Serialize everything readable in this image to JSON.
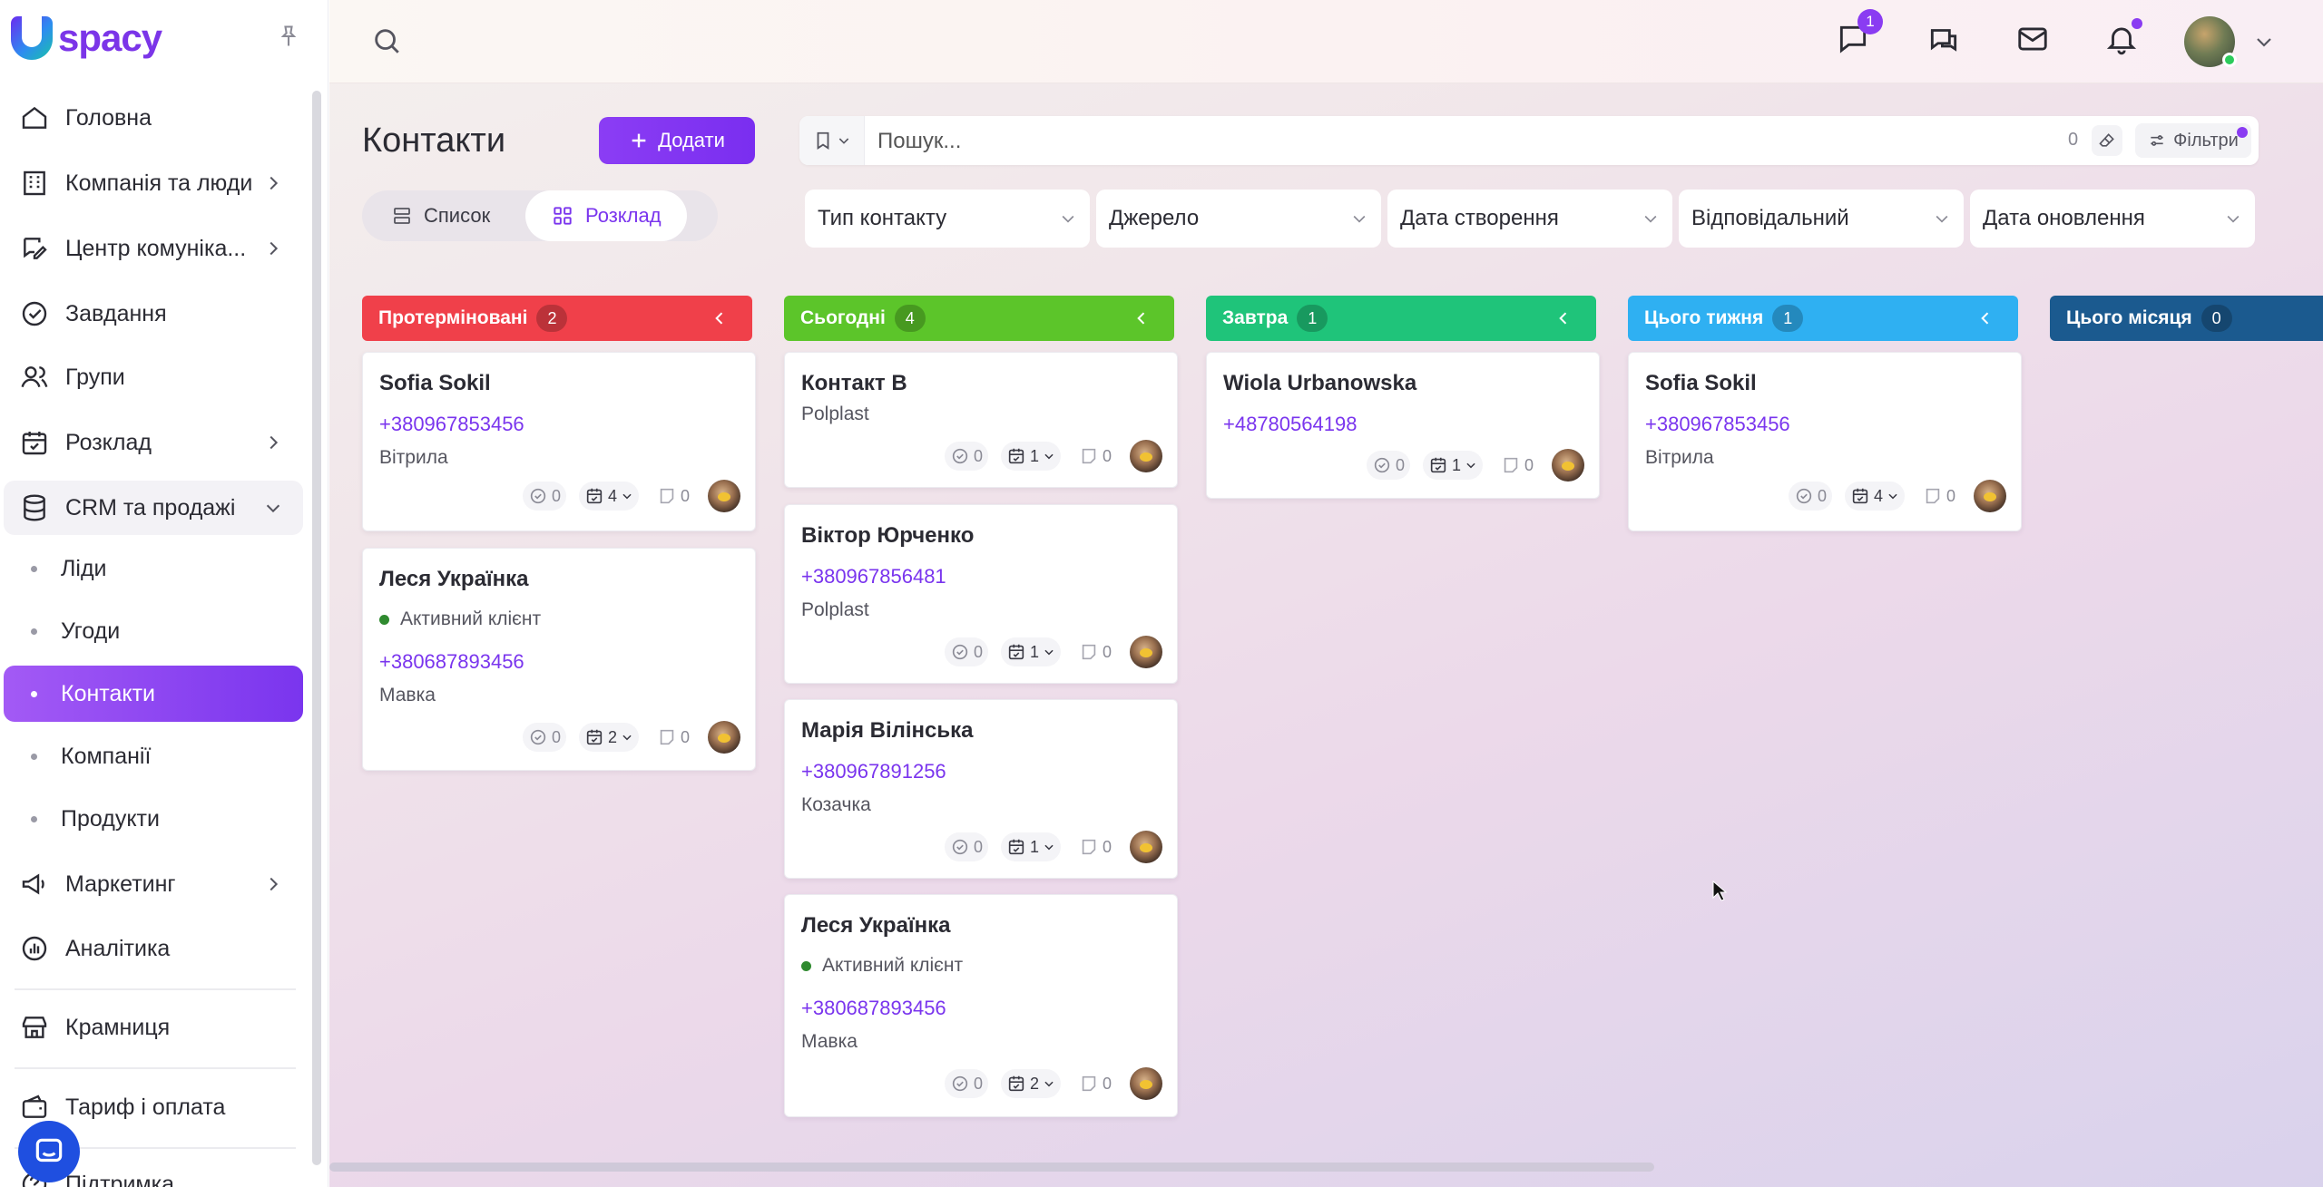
{
  "brand": {
    "logo_text": "spacy"
  },
  "sidebar": {
    "items": [
      {
        "label": "Головна",
        "icon": "home-icon"
      },
      {
        "label": "Компанія та люди",
        "icon": "building-icon"
      },
      {
        "label": "Центр комуніка...",
        "icon": "chat-edit-icon"
      },
      {
        "label": "Завдання",
        "icon": "check-circle-icon"
      },
      {
        "label": "Групи",
        "icon": "users-icon"
      },
      {
        "label": "Розклад",
        "icon": "calendar-icon"
      },
      {
        "label": "CRM та продажі",
        "icon": "database-icon"
      },
      {
        "label": "Маркетинг",
        "icon": "megaphone-icon"
      },
      {
        "label": "Аналітика",
        "icon": "chart-icon"
      },
      {
        "label": "Крамниця",
        "icon": "store-icon"
      },
      {
        "label": "Тариф і оплата",
        "icon": "wallet-icon"
      },
      {
        "label": "Підтримка",
        "icon": "support-icon"
      }
    ],
    "crm_sub": [
      "Ліди",
      "Угоди",
      "Контакти",
      "Компанії",
      "Продукти"
    ]
  },
  "topbar": {
    "messages_badge": "1"
  },
  "page": {
    "title": "Контакти",
    "add_label": "Додати",
    "view_list": "Список",
    "view_board": "Розклад",
    "search_placeholder": "Пошук...",
    "search_count": "0",
    "filters_label": "Фільтри",
    "filter_dropdowns": [
      "Тип контакту",
      "Джерело",
      "Дата створення",
      "Відповідальний",
      "Дата оновлення"
    ]
  },
  "colors": {
    "accent": "#7a35ee",
    "overdue": "#f0404a",
    "today": "#5cc52a",
    "tomorrow": "#1fc47a",
    "this_week": "#2fb0f2",
    "this_month": "#1b5a8f"
  },
  "columns": [
    {
      "title": "Протерміновані",
      "count": "2",
      "cards": [
        {
          "name": "Sofia Sokil",
          "phone": "+380967853456",
          "sub": "Вітрила",
          "status": "",
          "tasks": "0",
          "events": "4",
          "notes": "0"
        },
        {
          "name": "Леся Українка",
          "phone": "+380687893456",
          "sub": "Мавка",
          "status": "Активний клієнт",
          "tasks": "0",
          "events": "2",
          "notes": "0"
        }
      ]
    },
    {
      "title": "Сьогодні",
      "count": "4",
      "cards": [
        {
          "name": "Контакт В",
          "phone": "",
          "sub": "Polplast",
          "status": "",
          "tasks": "0",
          "events": "1",
          "notes": "0"
        },
        {
          "name": "Віктор Юрченко",
          "phone": "+380967856481",
          "sub": "Polplast",
          "status": "",
          "tasks": "0",
          "events": "1",
          "notes": "0"
        },
        {
          "name": "Марія Вілінська",
          "phone": "+380967891256",
          "sub": "Козачка",
          "status": "",
          "tasks": "0",
          "events": "1",
          "notes": "0"
        },
        {
          "name": "Леся Українка",
          "phone": "+380687893456",
          "sub": "Мавка",
          "status": "Активний клієнт",
          "tasks": "0",
          "events": "2",
          "notes": "0"
        }
      ]
    },
    {
      "title": "Завтра",
      "count": "1",
      "cards": [
        {
          "name": "Wiola Urbanowska",
          "phone": "+48780564198",
          "sub": "",
          "status": "",
          "tasks": "0",
          "events": "1",
          "notes": "0"
        }
      ]
    },
    {
      "title": "Цього тижня",
      "count": "1",
      "cards": [
        {
          "name": "Sofia Sokil",
          "phone": "+380967853456",
          "sub": "Вітрила",
          "status": "",
          "tasks": "0",
          "events": "4",
          "notes": "0"
        }
      ]
    },
    {
      "title": "Цього місяця",
      "count": "0",
      "cards": []
    }
  ]
}
